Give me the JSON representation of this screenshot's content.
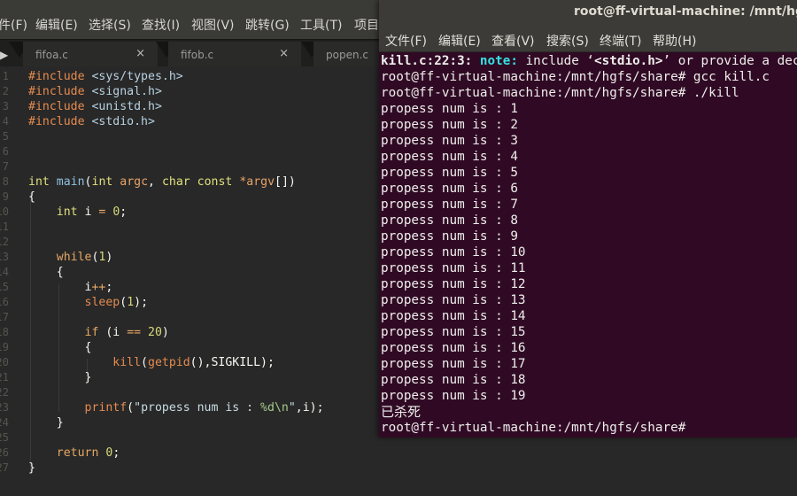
{
  "editor": {
    "menu": [
      "件(F)",
      "编辑(E)",
      "选择(S)",
      "查找(I)",
      "视图(V)",
      "跳转(G)",
      "工具(T)",
      "项目"
    ],
    "tabs": [
      {
        "label": "fifoa.c",
        "close": "×"
      },
      {
        "label": "fifob.c",
        "close": "×"
      },
      {
        "label": "popen.c",
        "close": ""
      }
    ],
    "tab_arrow": "▶",
    "line_numbers": [
      "1",
      "2",
      "3",
      "4",
      "5",
      "6",
      "7",
      "8",
      "9",
      "10",
      "11",
      "12",
      "13",
      "14",
      "15",
      "16",
      "17",
      "18",
      "19",
      "20",
      "21",
      "22",
      "23",
      "24",
      "25",
      "26",
      "27"
    ],
    "code": [
      "#include <sys/types.h>",
      "#include <signal.h>",
      "#include <unistd.h>",
      "#include <stdio.h>",
      "",
      "",
      "",
      "int main(int argc, char const *argv[])",
      "{",
      "    int i = 0;",
      "",
      "",
      "    while(1)",
      "    {",
      "        i++;",
      "        sleep(1);",
      "",
      "        if (i == 20)",
      "        {",
      "            kill(getpid(),SIGKILL);",
      "        }",
      "",
      "        printf(\"propess num is : %d\\n\",i);",
      "    }",
      "",
      "    return 0;",
      "}"
    ]
  },
  "terminal": {
    "title": "root@ff-virtual-machine: /mnt/hgfs/share",
    "menu": [
      "文件(F)",
      "编辑(E)",
      "查看(V)",
      "搜索(S)",
      "终端(T)",
      "帮助(H)"
    ],
    "note_line": {
      "location": "kill.c:22:3:",
      "label": "note:",
      "pre": " include ‘",
      "header": "<stdio.h>",
      "post": "’ or provide a declaration of ‘printf’"
    },
    "lines_before": [
      "root@ff-virtual-machine:/mnt/hgfs/share# gcc kill.c",
      "root@ff-virtual-machine:/mnt/hgfs/share# ./kill"
    ],
    "output_lines": [
      "propess num is : 1",
      "propess num is : 2",
      "propess num is : 3",
      "propess num is : 4",
      "propess num is : 5",
      "propess num is : 6",
      "propess num is : 7",
      "propess num is : 8",
      "propess num is : 9",
      "propess num is : 10",
      "propess num is : 11",
      "propess num is : 12",
      "propess num is : 13",
      "propess num is : 14",
      "propess num is : 15",
      "propess num is : 16",
      "propess num is : 17",
      "propess num is : 18",
      "propess num is : 19"
    ],
    "killed_message": "已杀死",
    "final_prompt": "root@ff-virtual-machine:/mnt/hgfs/share#"
  }
}
